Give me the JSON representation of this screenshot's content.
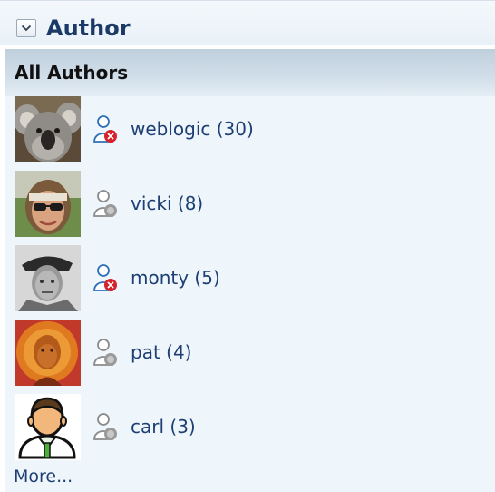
{
  "panel": {
    "title": "Author",
    "section_title": "All Authors",
    "more_label": "More..."
  },
  "authors": [
    {
      "label": "weblogic (30)",
      "status_icon": "user-offline-icon",
      "avatar": "koala-photo"
    },
    {
      "label": "vicki (8)",
      "status_icon": "user-unknown-icon",
      "avatar": "woman-sunglasses-photo"
    },
    {
      "label": "monty (5)",
      "status_icon": "user-offline-icon",
      "avatar": "man-beret-photo"
    },
    {
      "label": "pat (4)",
      "status_icon": "user-unknown-icon",
      "avatar": "man-orange-portrait"
    },
    {
      "label": "carl (3)",
      "status_icon": "user-unknown-icon",
      "avatar": "default-user-avatar"
    }
  ],
  "colors": {
    "title": "#1c3a67",
    "link": "#1d3f73",
    "list_background": "#eef5fb",
    "section_bar": "#cfdde8",
    "offline_badge": "#d4232c"
  }
}
